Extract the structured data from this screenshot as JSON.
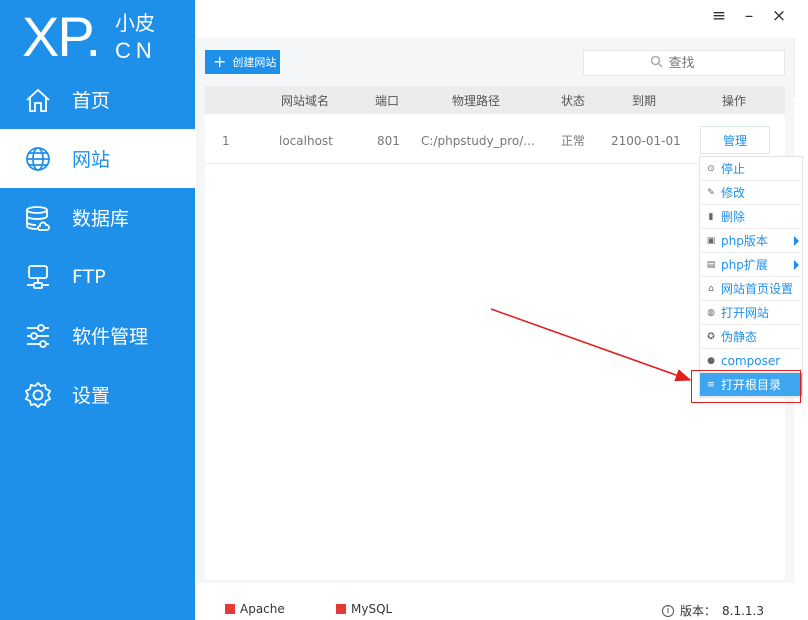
{
  "logo": {
    "xp": "XP.",
    "cn_top": "小皮",
    "cn_bottom": "CN"
  },
  "sidebar": {
    "items": [
      {
        "label": "首页",
        "icon": "home-icon"
      },
      {
        "label": "网站",
        "icon": "globe-icon",
        "active": true
      },
      {
        "label": "数据库",
        "icon": "database-icon"
      },
      {
        "label": "FTP",
        "icon": "ftp-icon"
      },
      {
        "label": "软件管理",
        "icon": "sliders-icon"
      },
      {
        "label": "设置",
        "icon": "gear-icon"
      }
    ]
  },
  "window": {
    "menu": "≡",
    "minimize": "–",
    "close": "×"
  },
  "toolbar": {
    "create_label": "创建网站",
    "search_placeholder": "查找"
  },
  "table": {
    "headers": [
      "网站域名",
      "端口",
      "物理路径",
      "状态",
      "到期",
      "操作"
    ],
    "rows": [
      {
        "index": "1",
        "domain": "localhost",
        "port": "801",
        "path": "C:/phpstudy_pro/...",
        "status": "正常",
        "expiry": "2100-01-01",
        "action": "管理"
      }
    ]
  },
  "menu": {
    "items": [
      {
        "label": "停止",
        "icon": "stop-icon"
      },
      {
        "label": "修改",
        "icon": "edit-icon"
      },
      {
        "label": "删除",
        "icon": "trash-icon"
      },
      {
        "label": "php版本",
        "icon": "php-version-icon",
        "submenu": true
      },
      {
        "label": "php扩展",
        "icon": "php-extension-icon",
        "submenu": true
      },
      {
        "label": "网站首页设置",
        "icon": "home-settings-icon"
      },
      {
        "label": "打开网站",
        "icon": "open-site-icon"
      },
      {
        "label": "伪静态",
        "icon": "rewrite-icon"
      },
      {
        "label": "composer",
        "icon": "composer-icon"
      },
      {
        "label": "打开根目录",
        "icon": "folder-list-icon",
        "highlight": true
      }
    ]
  },
  "status": {
    "apache": "Apache",
    "mysql": "MySQL",
    "version_label": "版本：",
    "version": "8.1.1.3",
    "status_color": "#e53935"
  },
  "colors": {
    "accent": "#1f90e9",
    "annotation": "#e02020"
  }
}
